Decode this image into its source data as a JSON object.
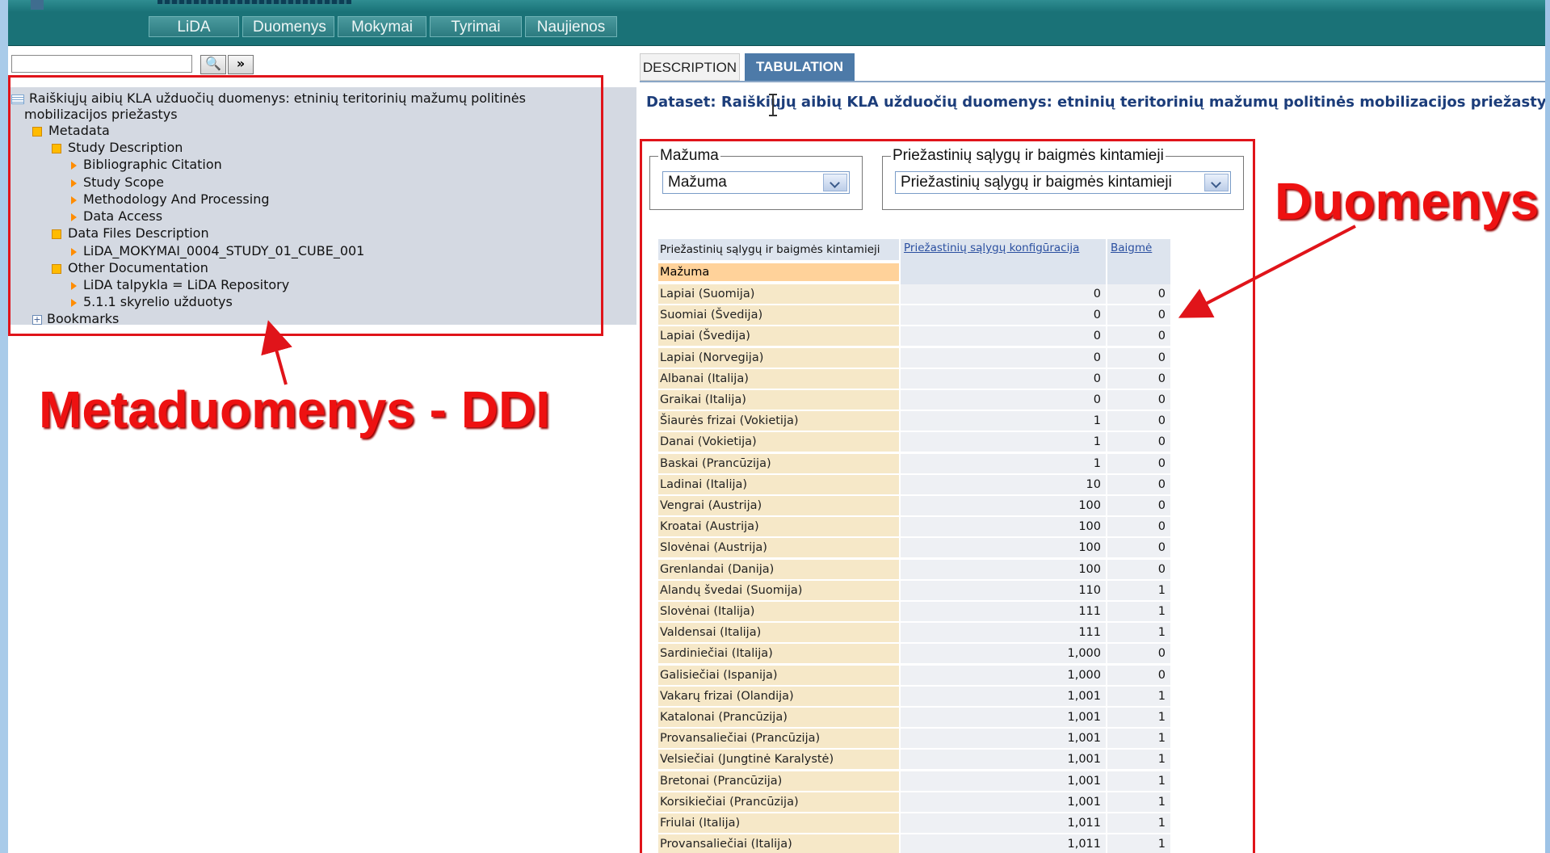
{
  "nav": [
    "LiDA",
    "Duomenys",
    "Mokymai",
    "Tyrimai",
    "Naujienos"
  ],
  "icons": {
    "search": "binoculars-icon",
    "go": "double-chevron-right-icon"
  },
  "tree": {
    "root": "Raiškiųjų aibių KLA užduočių duomenys: etninių teritorinių mažumų politinės",
    "root2": "mobilizacijos priežastys",
    "metadata": "Metadata",
    "study_desc": "Study Description",
    "bib": "Bibliographic Citation",
    "scope": "Study Scope",
    "method": "Methodology And Processing",
    "access": "Data Access",
    "files_desc": "Data Files Description",
    "cube": "LiDA_MOKYMAI_0004_STUDY_01_CUBE_001",
    "other_doc": "Other Documentation",
    "repo": "LiDA talpykla = LiDA Repository",
    "task": "5.1.1 skyrelio užduotys",
    "bookmarks": "Bookmarks"
  },
  "tabs": {
    "description": "DESCRIPTION",
    "tabulation": "TABULATION"
  },
  "dataset_title": "Dataset: Raiškiųjų aibių KLA užduočių duomenys: etninių teritorinių mažumų politinės mobilizacijos priežastys",
  "filters": {
    "f1_legend": "Mažuma",
    "f1_value": "Mažuma",
    "f2_legend": "Priežastinių sąlygų ir baigmės kintamieji",
    "f2_value": "Priežastinių sąlygų ir baigmės kintamieji"
  },
  "table": {
    "corner": "Priežastinių sąlygų ir baigmės kintamieji",
    "col1": "Priežastinių sąlygų konfigūracija",
    "col2": "Baigmė",
    "row_dim": "Mažuma",
    "rows": [
      {
        "label": "Lapiai (Suomija)",
        "config": "0",
        "outcome": "0"
      },
      {
        "label": "Suomiai (Švedija)",
        "config": "0",
        "outcome": "0"
      },
      {
        "label": "Lapiai (Švedija)",
        "config": "0",
        "outcome": "0"
      },
      {
        "label": "Lapiai (Norvegija)",
        "config": "0",
        "outcome": "0"
      },
      {
        "label": "Albanai (Italija)",
        "config": "0",
        "outcome": "0"
      },
      {
        "label": "Graikai (Italija)",
        "config": "0",
        "outcome": "0"
      },
      {
        "label": "Šiaurės frizai (Vokietija)",
        "config": "1",
        "outcome": "0"
      },
      {
        "label": "Danai (Vokietija)",
        "config": "1",
        "outcome": "0"
      },
      {
        "label": "Baskai (Prancūzija)",
        "config": "1",
        "outcome": "0"
      },
      {
        "label": "Ladinai (Italija)",
        "config": "10",
        "outcome": "0"
      },
      {
        "label": "Vengrai (Austrija)",
        "config": "100",
        "outcome": "0"
      },
      {
        "label": "Kroatai (Austrija)",
        "config": "100",
        "outcome": "0"
      },
      {
        "label": "Slovėnai (Austrija)",
        "config": "100",
        "outcome": "0"
      },
      {
        "label": "Grenlandai (Danija)",
        "config": "100",
        "outcome": "0"
      },
      {
        "label": "Alandų švedai (Suomija)",
        "config": "110",
        "outcome": "1"
      },
      {
        "label": "Slovėnai (Italija)",
        "config": "111",
        "outcome": "1"
      },
      {
        "label": "Valdensai (Italija)",
        "config": "111",
        "outcome": "1"
      },
      {
        "label": "Sardiniečiai (Italija)",
        "config": "1,000",
        "outcome": "0"
      },
      {
        "label": "Galisiečiai (Ispanija)",
        "config": "1,000",
        "outcome": "0"
      },
      {
        "label": "Vakarų frizai (Olandija)",
        "config": "1,001",
        "outcome": "1"
      },
      {
        "label": "Katalonai (Prancūzija)",
        "config": "1,001",
        "outcome": "1"
      },
      {
        "label": "Provansaliečiai (Prancūzija)",
        "config": "1,001",
        "outcome": "1"
      },
      {
        "label": "Velsiečiai (Jungtinė Karalystė)",
        "config": "1,001",
        "outcome": "1"
      },
      {
        "label": "Bretonai (Prancūzija)",
        "config": "1,001",
        "outcome": "1"
      },
      {
        "label": "Korsikiečiai (Prancūzija)",
        "config": "1,001",
        "outcome": "1"
      },
      {
        "label": "Friulai (Italija)",
        "config": "1,011",
        "outcome": "1"
      },
      {
        "label": "Provansaliečiai (Italija)",
        "config": "1,011",
        "outcome": "1"
      }
    ]
  },
  "annotations": {
    "left": "Metaduomenys - DDI",
    "right": "Duomenys"
  },
  "colors": {
    "accent_red": "#e0141a",
    "nav_teal": "#1a7277",
    "tab_blue": "#4d7aa8"
  }
}
